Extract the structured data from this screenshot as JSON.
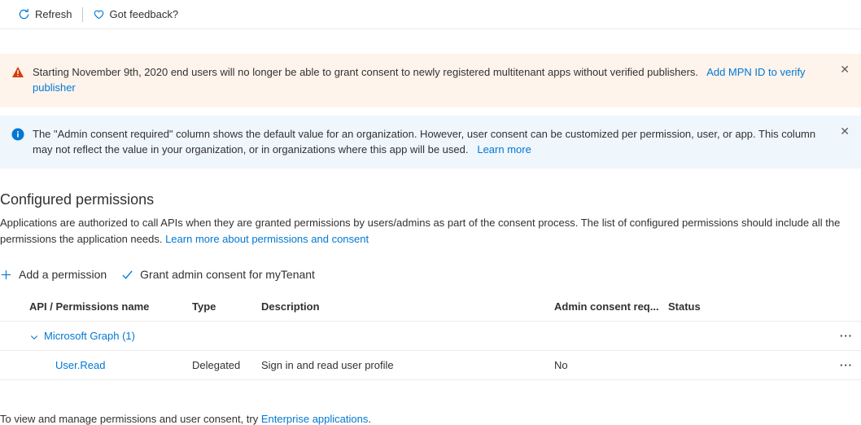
{
  "toolbar": {
    "refresh": "Refresh",
    "feedback": "Got feedback?"
  },
  "banners": {
    "warning": {
      "text": "Starting November 9th, 2020 end users will no longer be able to grant consent to newly registered multitenant apps without verified publishers.",
      "link": "Add MPN ID to verify publisher"
    },
    "info": {
      "text": "The \"Admin consent required\" column shows the default value for an organization. However, user consent can be customized per permission, user, or app. This column may not reflect the value in your organization, or in organizations where this app will be used.",
      "link": "Learn more"
    }
  },
  "section": {
    "title": "Configured permissions",
    "desc": "Applications are authorized to call APIs when they are granted permissions by users/admins as part of the consent process. The list of configured permissions should include all the permissions the application needs.",
    "desc_link": "Learn more about permissions and consent"
  },
  "actions": {
    "add": "Add a permission",
    "grant": "Grant admin consent for myTenant"
  },
  "table": {
    "headers": {
      "name": "API / Permissions name",
      "type": "Type",
      "desc": "Description",
      "admin": "Admin consent req...",
      "status": "Status"
    },
    "group": {
      "label": "Microsoft Graph (1)"
    },
    "rows": [
      {
        "name": "User.Read",
        "type": "Delegated",
        "desc": "Sign in and read user profile",
        "admin": "No",
        "status": ""
      }
    ]
  },
  "footer": {
    "text": "To view and manage permissions and user consent, try ",
    "link": "Enterprise applications"
  }
}
